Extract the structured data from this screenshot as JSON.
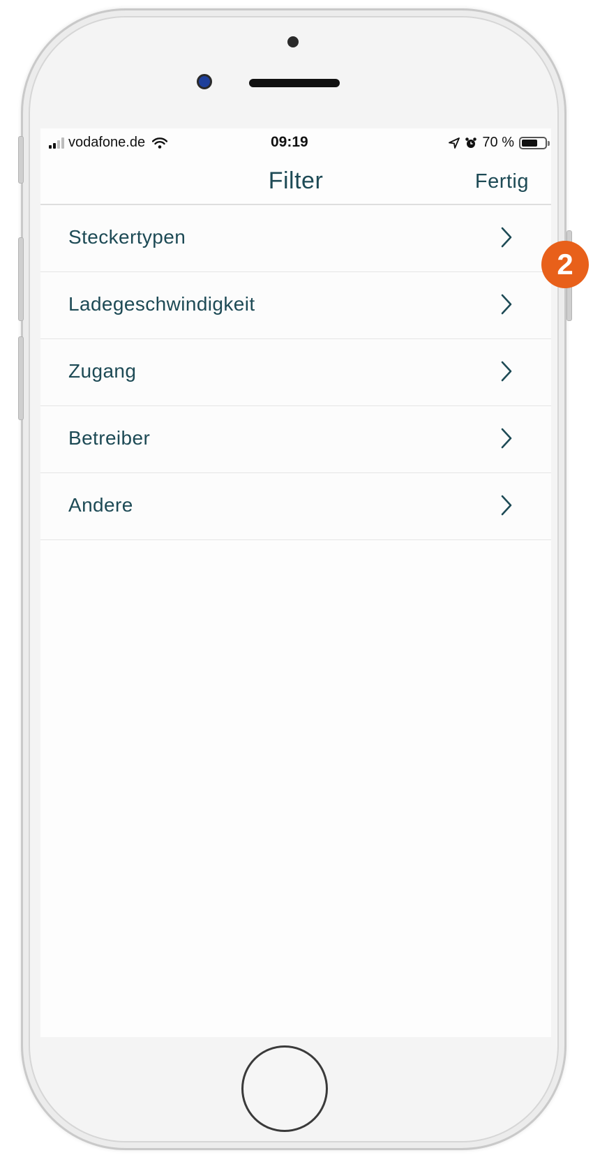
{
  "status_bar": {
    "carrier": "vodafone.de",
    "time": "09:19",
    "battery_text": "70 %",
    "battery_level": 0.7,
    "icons": [
      "signal-icon",
      "wifi-icon",
      "location-icon",
      "alarm-icon",
      "battery-icon"
    ]
  },
  "nav": {
    "title": "Filter",
    "done_label": "Fertig"
  },
  "filters": [
    {
      "label": "Steckertypen"
    },
    {
      "label": "Ladegeschwindigkeit"
    },
    {
      "label": "Zugang"
    },
    {
      "label": "Betreiber"
    },
    {
      "label": "Andere"
    }
  ],
  "badge": {
    "number": "2",
    "color": "#e8601a"
  },
  "colors": {
    "text_primary": "#1d4a55",
    "separator": "#e4e4e4"
  }
}
